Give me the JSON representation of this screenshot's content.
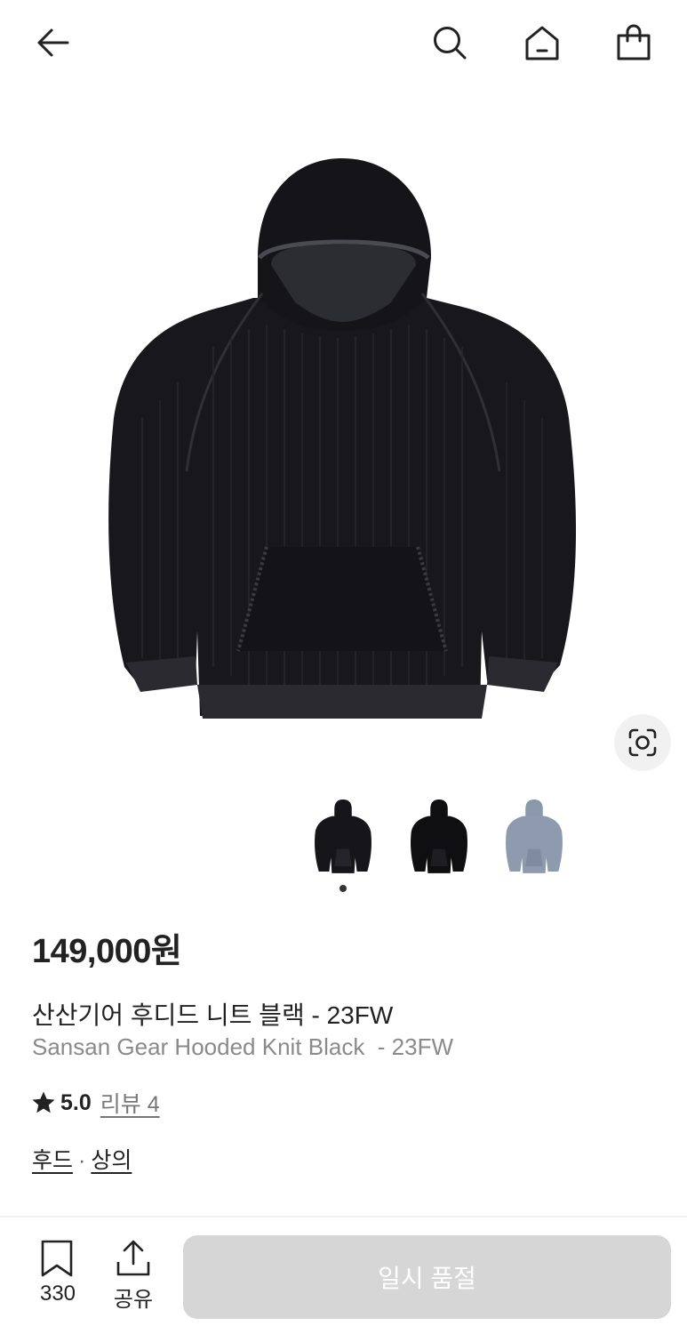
{
  "header": {
    "back_icon": "arrow-left-icon",
    "search_icon": "search-icon",
    "home_icon": "home-icon",
    "bag_icon": "shopping-bag-icon"
  },
  "product": {
    "image": "black-knit-hoodie",
    "thumbnails": [
      "black-knit-hoodie",
      "black-knit-hoodie",
      "grey-blue-knit-hoodie"
    ],
    "price": "149,000원",
    "name_ko": "산산기어 후디드 니트 블랙 - 23FW",
    "name_en": "Sansan Gear Hooded Knit Black  - 23FW",
    "rating": "5.0",
    "reviews": "리뷰 4",
    "categories": [
      "후드",
      "상의"
    ],
    "category_separator": "·"
  },
  "bottom_bar": {
    "save_count": "330",
    "share_label": "공유",
    "action_label": "일시 품절"
  },
  "colors": {
    "text": "#222222",
    "secondary_text": "#8a8a8a",
    "disabled_button": "#d6d6d6",
    "hoodie_black": "#1a1a1e",
    "hoodie_grey": "#8a98ab"
  }
}
